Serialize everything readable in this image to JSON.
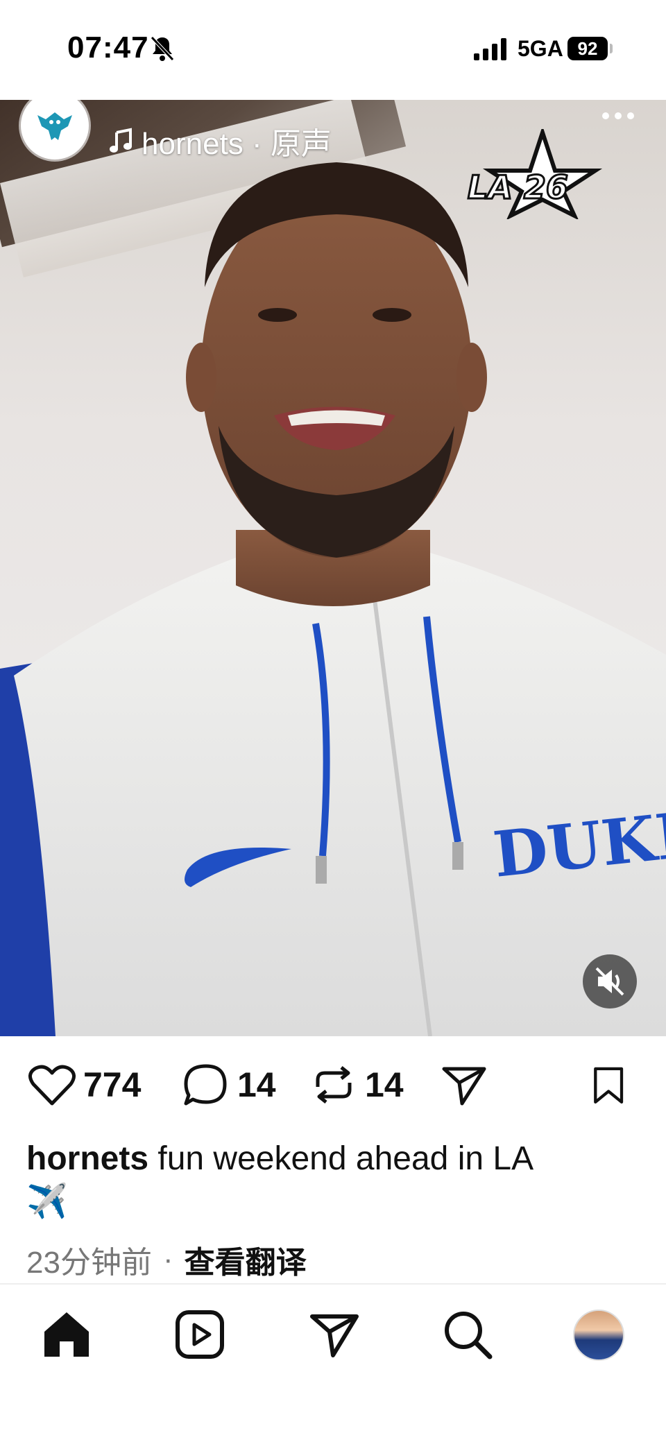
{
  "status_bar": {
    "time": "07:47",
    "network": "5GA",
    "battery": "92"
  },
  "post": {
    "account_name": "hornets",
    "audio_label": "hornets · 原声",
    "event_logo_text": "LA 26",
    "likes": "774",
    "comments": "14",
    "reposts": "14",
    "caption_user": "hornets",
    "caption_text": " fun weekend ahead in LA",
    "caption_emoji": "✈️",
    "time_ago": "23分钟前",
    "separator": "·",
    "translate_label": "查看翻译"
  },
  "colors": {
    "duke_blue": "#1f4fc4",
    "hornets_teal": "#1d97b5",
    "text": "#111111",
    "muted": "#777777"
  },
  "icons": {
    "like": "heart-icon",
    "comment": "comment-icon",
    "repost": "repost-icon",
    "share": "send-icon",
    "save": "bookmark-icon",
    "nav": [
      "home-icon",
      "reels-icon",
      "send-icon",
      "search-icon",
      "profile-avatar"
    ]
  }
}
